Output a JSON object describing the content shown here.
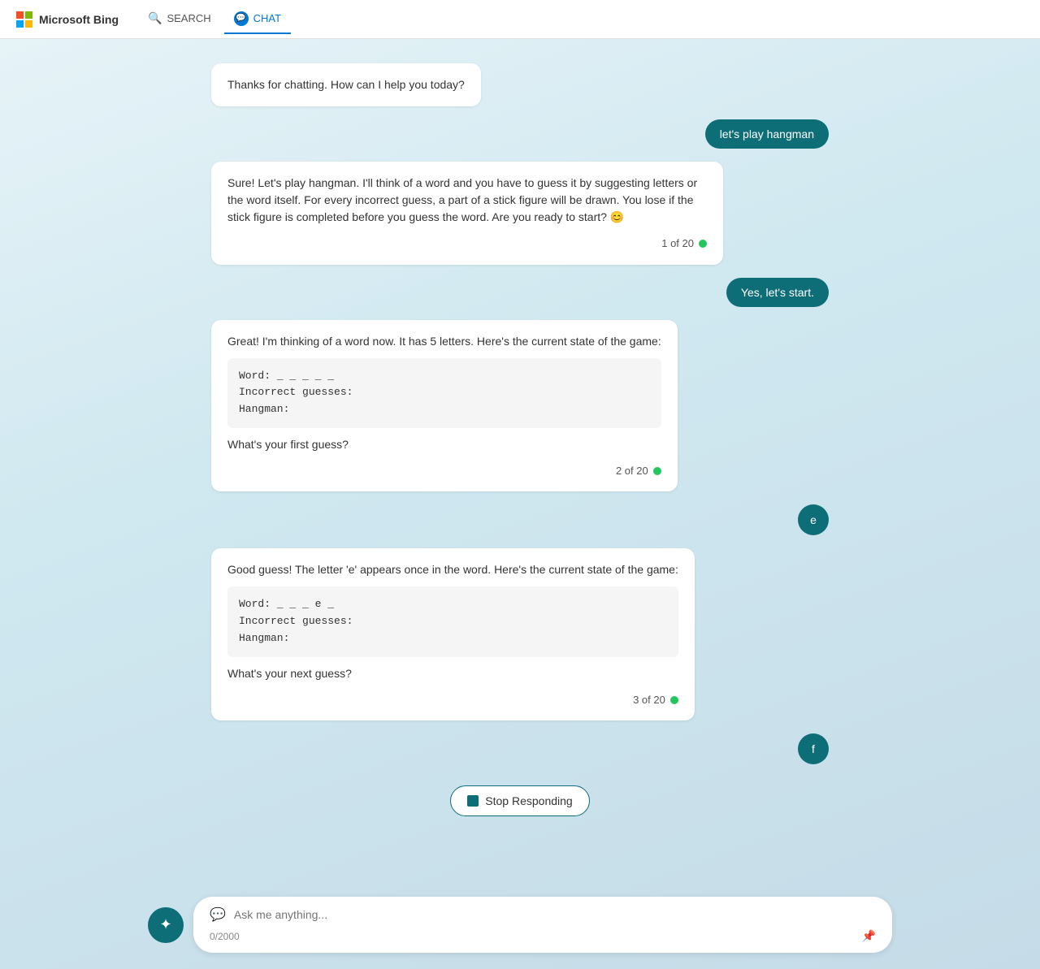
{
  "header": {
    "brand": "Microsoft Bing",
    "nav": [
      {
        "id": "search",
        "label": "SEARCH",
        "icon": "search",
        "active": false
      },
      {
        "id": "chat",
        "label": "CHAT",
        "icon": "chat",
        "active": true
      }
    ]
  },
  "messages": [
    {
      "id": "msg1",
      "type": "ai",
      "text": "Thanks for chatting. How can I help you today?",
      "counter": null
    },
    {
      "id": "msg2",
      "type": "user",
      "text": "let's play hangman",
      "shape": "pill"
    },
    {
      "id": "msg3",
      "type": "ai",
      "text": "Sure! Let's play hangman. I'll think of a word and you have to guess it by suggesting letters or the word itself. For every incorrect guess, a part of a stick figure will be drawn. You lose if the stick figure is completed before you guess the word. Are you ready to start? 😊",
      "counter": "1 of 20"
    },
    {
      "id": "msg4",
      "type": "user",
      "text": "Yes, let's start.",
      "shape": "pill"
    },
    {
      "id": "msg5",
      "type": "ai",
      "text": "Great! I'm thinking of a word now. It has 5 letters. Here's the current state of the game:",
      "code": "Word:  _ _ _ _ _\nIncorrect guesses:\nHangman:",
      "text2": "What's your first guess?",
      "counter": "2 of 20"
    },
    {
      "id": "msg6",
      "type": "user",
      "text": "e",
      "shape": "circle"
    },
    {
      "id": "msg7",
      "type": "ai",
      "text": "Good guess! The letter 'e' appears once in the word. Here's the current state of the game:",
      "code": "Word:  _ _ _ e _\nIncorrect guesses:\nHangman:",
      "text2": "What's your next guess?",
      "counter": "3 of 20"
    },
    {
      "id": "msg8",
      "type": "user",
      "text": "f",
      "shape": "circle"
    }
  ],
  "stop_btn": {
    "label": "Stop Responding"
  },
  "input": {
    "placeholder": "Ask me anything...",
    "char_count": "0/2000"
  }
}
